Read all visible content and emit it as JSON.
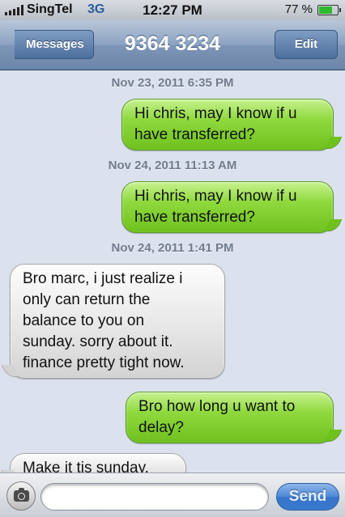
{
  "status_bar": {
    "carrier": "SingTel",
    "network": "3G",
    "time": "12:27 PM",
    "battery_percent": "77 %",
    "battery_level": 0.77,
    "signal_icon": "signal-bars-icon",
    "battery_icon": "battery-icon",
    "battery_color": "#2fb92f"
  },
  "nav": {
    "back_label": "Messages",
    "title": "9364 3234",
    "edit_label": "Edit"
  },
  "conversation": {
    "items": [
      {
        "type": "timestamp",
        "text": "Nov 23, 2011 6:35 PM"
      },
      {
        "type": "outgoing",
        "lines": [
          "Hi chris, may I know if u",
          "have transferred?"
        ]
      },
      {
        "type": "timestamp",
        "text": "Nov 24, 2011 11:13 AM"
      },
      {
        "type": "outgoing",
        "lines": [
          "Hi chris, may I know if u",
          "have transferred?"
        ]
      },
      {
        "type": "timestamp",
        "text": "Nov 24, 2011 1:41 PM"
      },
      {
        "type": "incoming",
        "lines": [
          "Bro marc, i just realize i",
          "only can return the",
          "balance to you on",
          "sunday. sorry about it.",
          "finance pretty tight now."
        ]
      },
      {
        "type": "outgoing",
        "lines": [
          "Bro how long u want to",
          "delay?"
        ]
      },
      {
        "type": "incoming",
        "lines": [
          "Make it tis sunday."
        ]
      }
    ]
  },
  "input_bar": {
    "camera_icon": "camera-icon",
    "message_value": "",
    "send_label": "Send"
  },
  "colors": {
    "outgoing_bubble": "#8fd93e",
    "incoming_bubble": "#e7e7e7",
    "send_button": "#4d88d6",
    "background": "#dbe2ed"
  }
}
